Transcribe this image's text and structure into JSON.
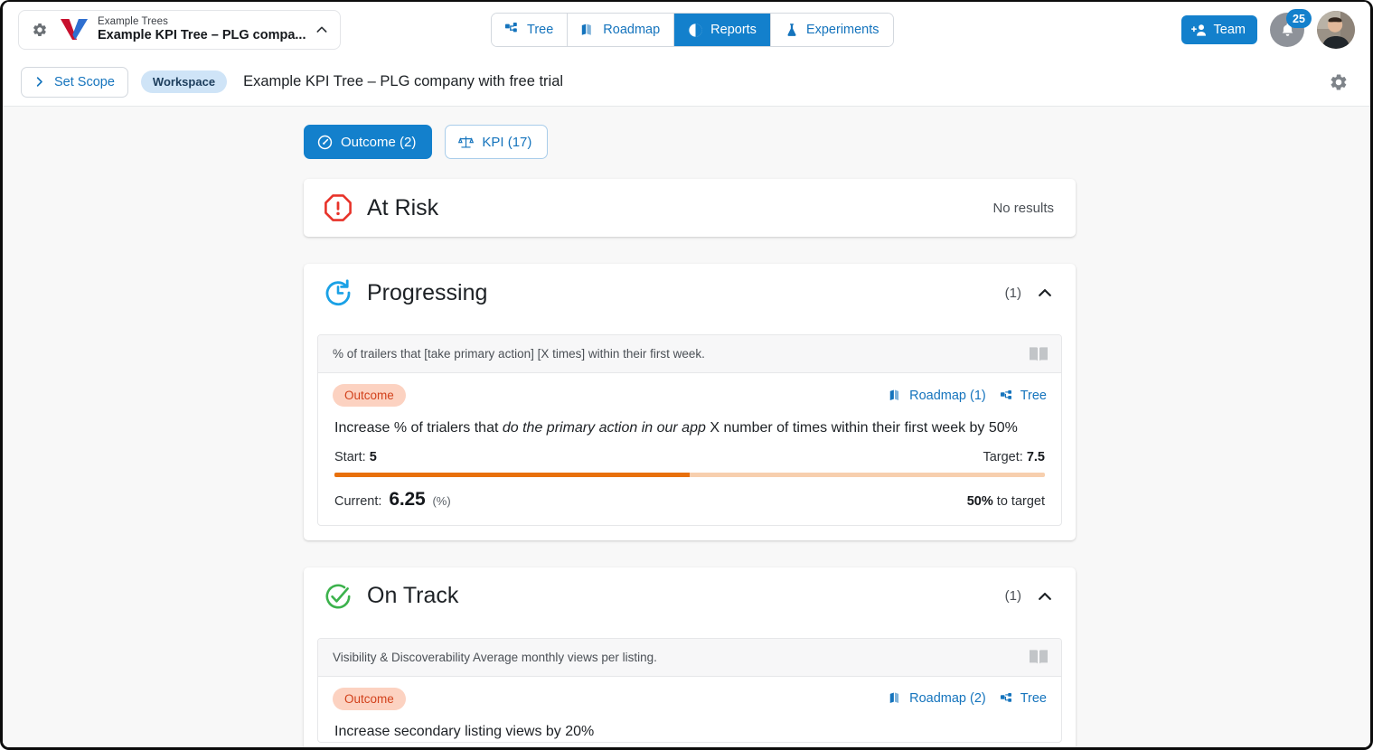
{
  "topbar": {
    "tree_selector": {
      "subtitle": "Example Trees",
      "title": "Example KPI Tree – PLG compa...",
      "settings_icon": "gear-icon",
      "logo_icon": "vistaly-v-logo",
      "chevron_icon": "chevron-up-icon"
    },
    "nav_tabs": [
      {
        "label": "Tree",
        "icon": "tree-hierarchy-icon",
        "active": false
      },
      {
        "label": "Roadmap",
        "icon": "roadmap-book-icon",
        "active": false
      },
      {
        "label": "Reports",
        "icon": "reports-pie-icon",
        "active": true
      },
      {
        "label": "Experiments",
        "icon": "flask-icon",
        "active": false
      }
    ],
    "team_button": {
      "label": "Team",
      "icon": "add-person-icon"
    },
    "notifications": {
      "count": "25",
      "icon": "bell-icon"
    },
    "avatar": {
      "icon": "user-avatar"
    }
  },
  "scopebar": {
    "set_scope_label": "Set Scope",
    "set_scope_icon": "chevron-right-icon",
    "workspace_chip": "Workspace",
    "title": "Example KPI Tree – PLG company with free trial",
    "settings_icon": "gear-icon"
  },
  "filters": [
    {
      "label": "Outcome (2)",
      "icon": "gauge-icon",
      "active": true
    },
    {
      "label": "KPI (17)",
      "icon": "scales-icon",
      "active": false
    }
  ],
  "sections": [
    {
      "key": "at_risk",
      "title": "At Risk",
      "icon": "at-risk-octagon-icon",
      "empty_text": "No results",
      "count": null,
      "collapsed": true
    },
    {
      "key": "progressing",
      "title": "Progressing",
      "icon": "progressing-clock-arrow-icon",
      "count": "(1)",
      "caret_icon": "chevron-up-icon",
      "metric": {
        "header_text": "% of trailers that [take primary action] [X times] within their first week.",
        "book_icon": "open-book-icon",
        "badge": "Outcome",
        "roadmap_link": "Roadmap (1)",
        "roadmap_icon": "roadmap-book-icon",
        "tree_link": "Tree",
        "tree_icon": "tree-hierarchy-icon",
        "description_pre": "Increase % of trialers that ",
        "description_em": "do the primary action in our app",
        "description_post": " X number of times within their first week by 50%",
        "start_label": "Start:",
        "start_value": "5",
        "target_label": "Target:",
        "target_value": "7.5",
        "progress_percent": 50,
        "current_label": "Current:",
        "current_value": "6.25",
        "current_unit": "(%)",
        "to_target_value": "50%",
        "to_target_label": " to target",
        "bar_fill_color": "#e8700c",
        "bar_track_color": "#f7cfae"
      }
    },
    {
      "key": "on_track",
      "title": "On Track",
      "icon": "on-track-check-circle-icon",
      "count": "(1)",
      "caret_icon": "chevron-up-icon",
      "metric": {
        "header_text": "Visibility & Discoverability Average monthly views per listing.",
        "book_icon": "open-book-icon",
        "badge": "Outcome",
        "roadmap_link": "Roadmap (2)",
        "roadmap_icon": "roadmap-book-icon",
        "tree_link": "Tree",
        "tree_icon": "tree-hierarchy-icon",
        "description_clipped": "Increase secondary listing views by 20%"
      }
    }
  ],
  "colors": {
    "accent_blue": "#1380cc",
    "link_blue": "#1574bd",
    "at_risk_red": "#e8332a",
    "on_track_green": "#3cb24c",
    "progressing_blue": "#1aa1e6",
    "outcome_badge_bg": "#fcd2c1",
    "outcome_badge_fg": "#d2411b",
    "page_bg": "#f8f8f8"
  }
}
